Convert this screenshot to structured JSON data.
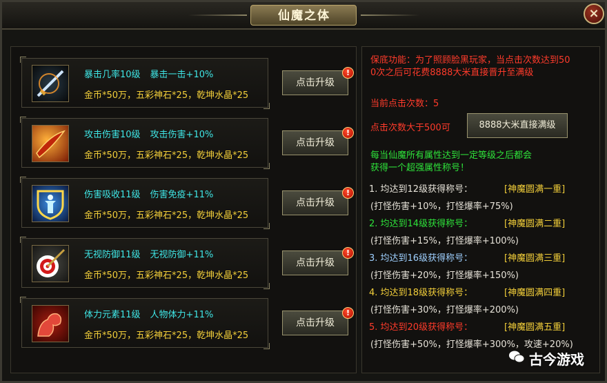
{
  "window": {
    "title": "仙魔之体",
    "close_label": "×"
  },
  "upgrade_rows": [
    {
      "icon": "sword-icon",
      "name_level": "暴击几率10级",
      "effect": "暴击一击+10%",
      "cost": "金币*50万，五彩神石*25，乾坤水晶*25",
      "button": "点击升级"
    },
    {
      "icon": "blade-flame-icon",
      "name_level": "攻击伤害10级",
      "effect": "攻击伤害+10%",
      "cost": "金币*50万，五彩神石*25，乾坤水晶*25",
      "button": "点击升级"
    },
    {
      "icon": "shield-figure-icon",
      "name_level": "伤害吸收11级",
      "effect": "伤害免疫+11%",
      "cost": "金币*50万，五彩神石*25，乾坤水晶*25",
      "button": "点击升级"
    },
    {
      "icon": "target-arrow-icon",
      "name_level": "无视防御11级",
      "effect": "无视防御+11%",
      "cost": "金币*50万，五彩神石*25，乾坤水晶*25",
      "button": "点击升级"
    },
    {
      "icon": "muscle-arm-icon",
      "name_level": "体力元素11级",
      "effect": "人物体力+11%",
      "cost": "金币*50万，五彩神石*25，乾坤水晶*25",
      "button": "点击升级"
    }
  ],
  "badge_symbol": "!",
  "right": {
    "guarantee_line1": "保底功能：为了照顾脸黑玩家，当点击次数达到50",
    "guarantee_line2": "0次之后可花费8888大米直接晋升至满级",
    "click_count": "当前点击次数：5",
    "over_500": "点击次数大于500可",
    "max_button": "8888大米直接满级",
    "info_line1": "每当仙魔所有属性达到一定等级之后都会",
    "info_line2": "获得一个超强属性称号！",
    "titles": [
      {
        "req": "1. 均达到12级获得称号：",
        "name": "[神魔圆满一重]",
        "bonus": "(打怪伤害+10%，打怪爆率+75%)"
      },
      {
        "req": "2. 均达到14级获得称号：",
        "name": "[神魔圆满二重]",
        "bonus": "(打怪伤害+15%，打怪爆率+100%)"
      },
      {
        "req": "3. 均达到16级获得称号：",
        "name": "[神魔圆满三重]",
        "bonus": "(打怪伤害+20%，打怪爆率+150%)"
      },
      {
        "req": "4. 均达到18级获得称号：",
        "name": "[神魔圆满四重]",
        "bonus": "(打怪伤害+30%，打怪爆率+200%)"
      },
      {
        "req": "5. 均达到20级获得称号：",
        "name": "[神魔圆满五重]",
        "bonus": "(打怪伤害+50%，打怪爆率+300%，攻速+20%)"
      }
    ]
  },
  "watermark": {
    "text": "古今游戏"
  },
  "colors": {
    "cyan": "#3fe6e6",
    "gold": "#f3cf3a",
    "red": "#ff3b2b",
    "green": "#2ee23a"
  }
}
